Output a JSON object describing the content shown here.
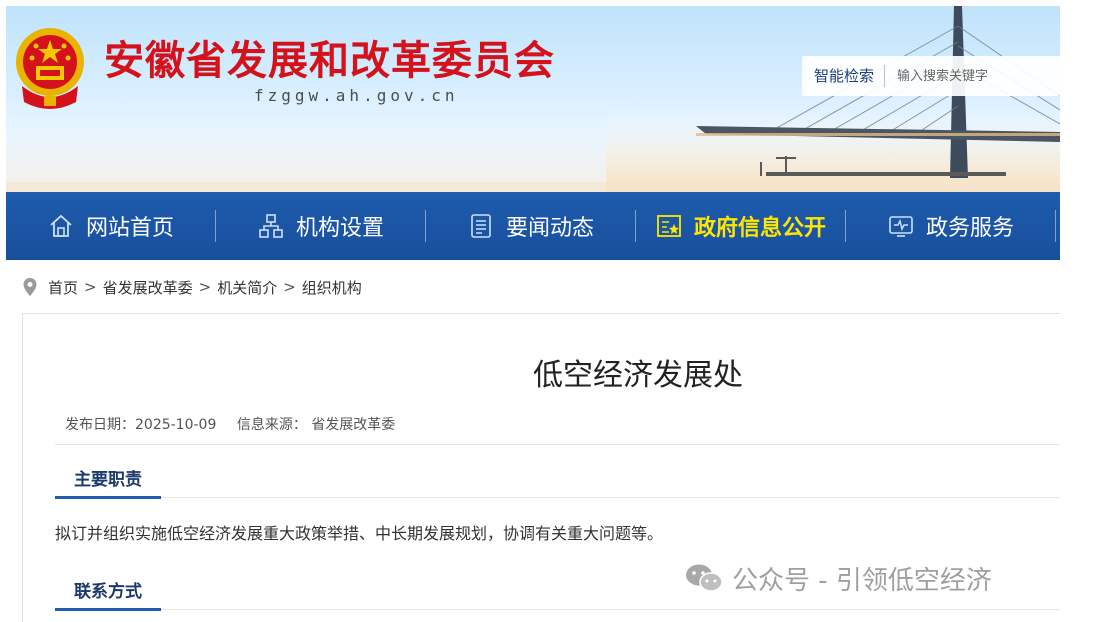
{
  "header": {
    "title": "安徽省发展和改革委员会",
    "domain": "fzggw.ah.gov.cn",
    "search": {
      "label": "智能检索",
      "placeholder": "输入搜索关键字"
    }
  },
  "nav": {
    "items": [
      {
        "label": "网站首页",
        "icon": "home-icon",
        "active": false
      },
      {
        "label": "机构设置",
        "icon": "org-chart-icon",
        "active": false
      },
      {
        "label": "要闻动态",
        "icon": "news-icon",
        "active": false
      },
      {
        "label": "政府信息公开",
        "icon": "info-board-icon",
        "active": true
      },
      {
        "label": "政务服务",
        "icon": "service-monitor-icon",
        "active": false
      }
    ],
    "active_color": "#ffe600",
    "bar_color": "#1f5cad"
  },
  "breadcrumb": {
    "items": [
      "首页",
      "省发展改革委",
      "机关简介",
      "组织机构"
    ],
    "separator": ">"
  },
  "article": {
    "title": "低空经济发展处",
    "meta": {
      "date": "发布日期：2025-10-09",
      "source": "信息来源：  省发展改革委"
    },
    "sections": [
      {
        "heading": "主要职责",
        "text": "拟订并组织实施低空经济发展重大政策举措、中长期发展规划，协调有关重大问题等。"
      },
      {
        "heading": "联系方式",
        "text": ""
      }
    ]
  },
  "watermark": {
    "text": "公众号 - 引领低空经济",
    "icon": "wechat-icon"
  },
  "colors": {
    "title_red": "#d4121b",
    "accent_blue": "#1f5cad"
  }
}
